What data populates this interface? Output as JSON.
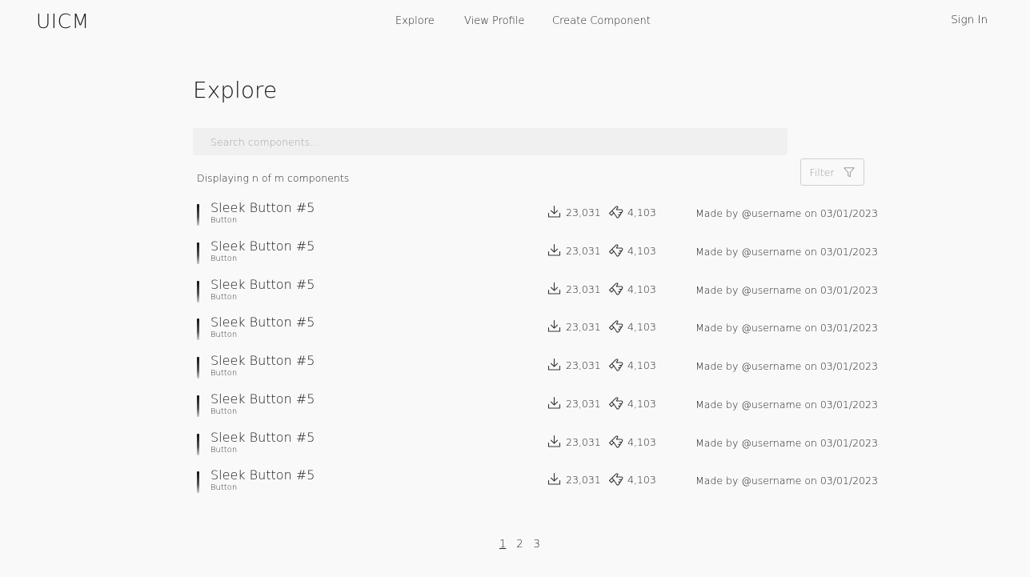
{
  "header": {
    "logo": "UICM",
    "nav": [
      "Explore",
      "View Profile",
      "Create Component"
    ],
    "sign_in": "Sign In"
  },
  "main": {
    "title": "Explore",
    "search_placeholder": "Search components...",
    "count_text": "Displaying n of m components",
    "filter_label": "Filter",
    "components": [
      {
        "name": "Sleek Button #5",
        "type": "Button",
        "downloads": "23,031",
        "likes": "4,103",
        "made_by": "Made by @username on 03/01/2023"
      },
      {
        "name": "Sleek Button #5",
        "type": "Button",
        "downloads": "23,031",
        "likes": "4,103",
        "made_by": "Made by @username on 03/01/2023"
      },
      {
        "name": "Sleek Button #5",
        "type": "Button",
        "downloads": "23,031",
        "likes": "4,103",
        "made_by": "Made by @username on 03/01/2023"
      },
      {
        "name": "Sleek Button #5",
        "type": "Button",
        "downloads": "23,031",
        "likes": "4,103",
        "made_by": "Made by @username on 03/01/2023"
      },
      {
        "name": "Sleek Button #5",
        "type": "Button",
        "downloads": "23,031",
        "likes": "4,103",
        "made_by": "Made by @username on 03/01/2023"
      },
      {
        "name": "Sleek Button #5",
        "type": "Button",
        "downloads": "23,031",
        "likes": "4,103",
        "made_by": "Made by @username on 03/01/2023"
      },
      {
        "name": "Sleek Button #5",
        "type": "Button",
        "downloads": "23,031",
        "likes": "4,103",
        "made_by": "Made by @username on 03/01/2023"
      },
      {
        "name": "Sleek Button #5",
        "type": "Button",
        "downloads": "23,031",
        "likes": "4,103",
        "made_by": "Made by @username on 03/01/2023"
      }
    ]
  },
  "pagination": {
    "pages": [
      "1",
      "2",
      "3"
    ],
    "current": "1"
  }
}
